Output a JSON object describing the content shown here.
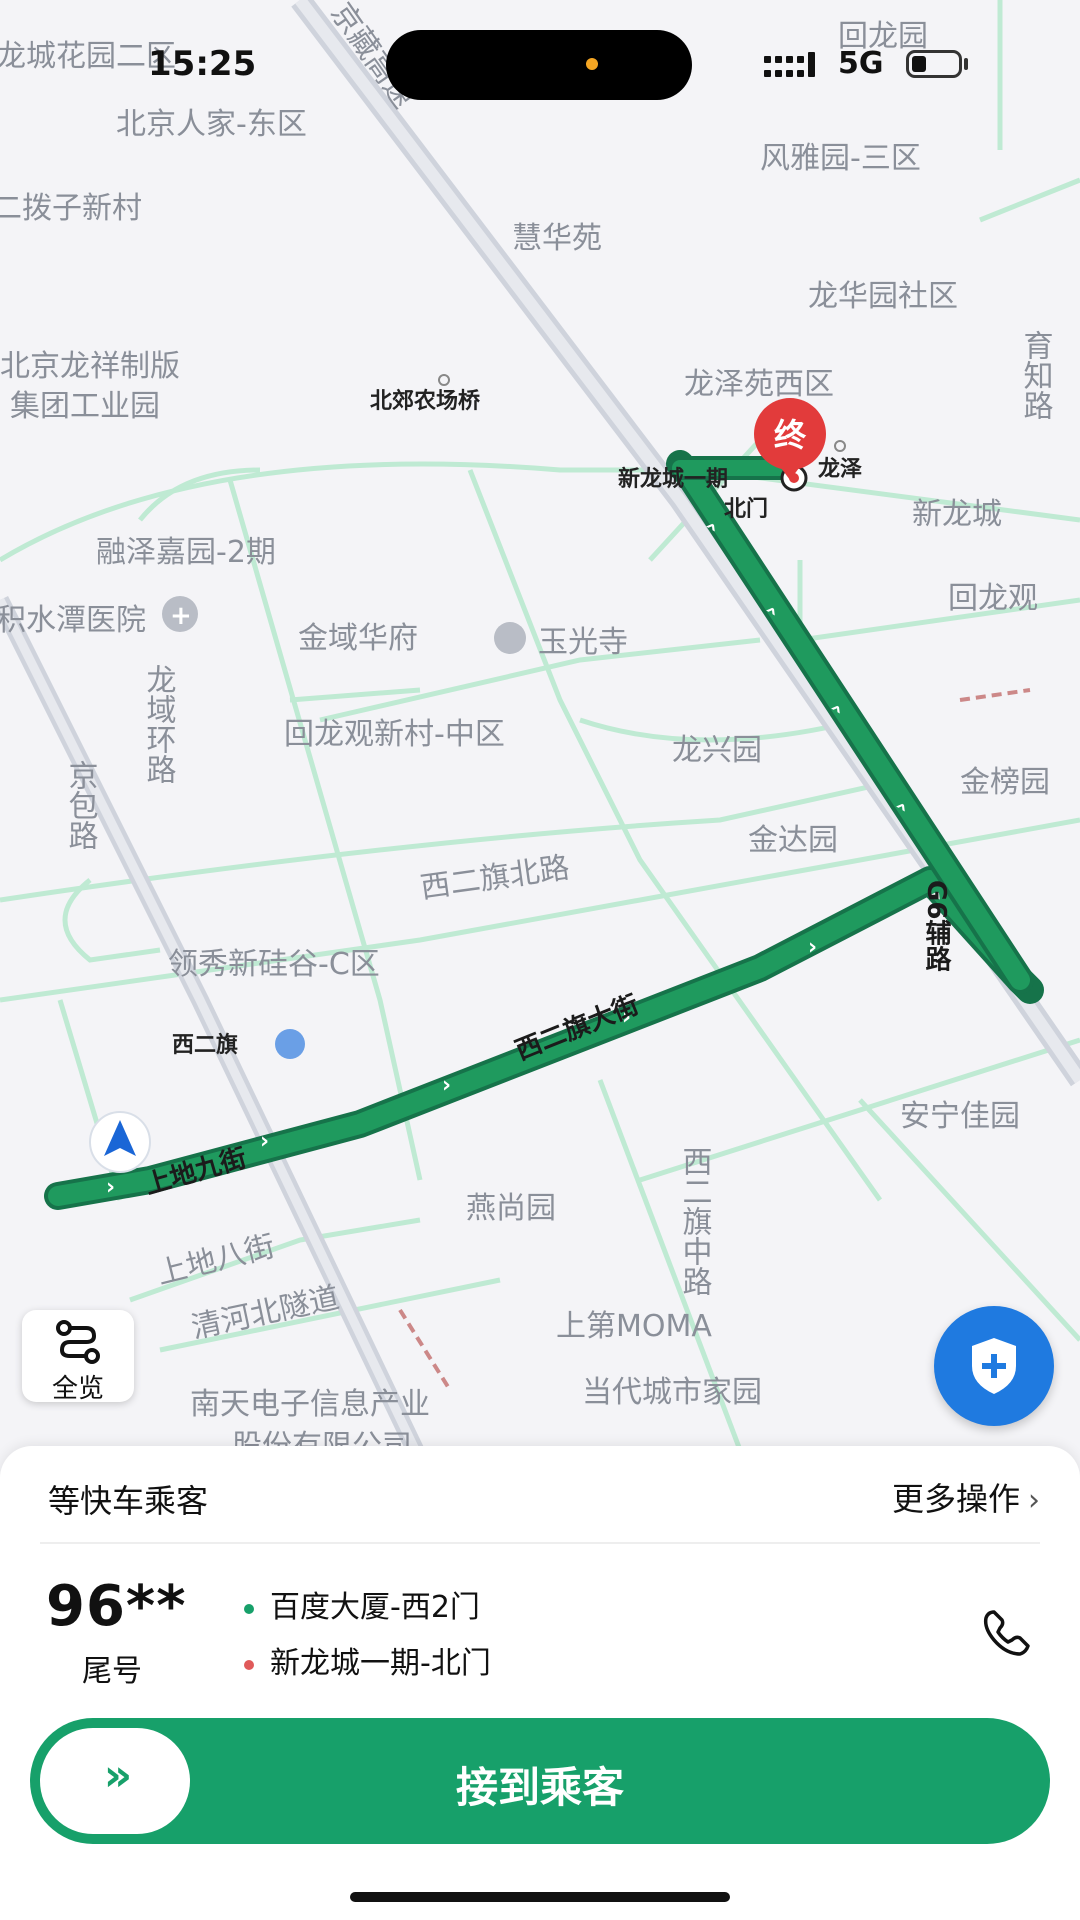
{
  "status_bar": {
    "time": "15:25",
    "network": "5G"
  },
  "map": {
    "labels": [
      {
        "id": "l1",
        "text": "龙城花园二区"
      },
      {
        "id": "l2",
        "text": "北京人家-东区"
      },
      {
        "id": "l3",
        "text": "二拨子新村"
      },
      {
        "id": "l4",
        "text": "慧华苑"
      },
      {
        "id": "l5",
        "text": "回龙园"
      },
      {
        "id": "l6",
        "text": "风雅园-三区"
      },
      {
        "id": "l7",
        "text": "龙华园社区"
      },
      {
        "id": "l8",
        "text": "北京龙祥制版"
      },
      {
        "id": "l9",
        "text": "集团工业园"
      },
      {
        "id": "l10",
        "text": "龙泽苑西区"
      },
      {
        "id": "l11",
        "text": "新龙城"
      },
      {
        "id": "l12",
        "text": "融泽嘉园-2期"
      },
      {
        "id": "l13",
        "text": "积水潭医院"
      },
      {
        "id": "l14",
        "text": "金域华府"
      },
      {
        "id": "l15",
        "text": "玉光寺"
      },
      {
        "id": "l16",
        "text": "回龙观"
      },
      {
        "id": "l17",
        "text": "回龙观新村-中区"
      },
      {
        "id": "l18",
        "text": "龙兴园"
      },
      {
        "id": "l19",
        "text": "金榜园"
      },
      {
        "id": "l20",
        "text": "金达园"
      },
      {
        "id": "l21",
        "text": "领秀新硅谷-C区"
      },
      {
        "id": "l22",
        "text": "西二旗"
      },
      {
        "id": "l23",
        "text": "安宁佳园"
      },
      {
        "id": "l24",
        "text": "燕尚园"
      },
      {
        "id": "l25",
        "text": "上第MOMA"
      },
      {
        "id": "l26",
        "text": "当代城市家园"
      },
      {
        "id": "l27",
        "text": "南天电子信息产业"
      },
      {
        "id": "l28",
        "text": "股份有限公司"
      }
    ],
    "small_labels": {
      "beijiao": "北郊农场桥",
      "longze": "龙泽",
      "xinlongcheng_stop": "新龙城一期",
      "beimen": "北门"
    },
    "road_labels": {
      "jingzang": "京藏高速",
      "yuzhi": "育知路",
      "longyu": "龙域环路",
      "jingbao": "京包路",
      "xierqi_north": "西二旗北路",
      "xierqi_main": "西二旗大街",
      "g6": "G6辅路",
      "shangdi9": "上地九街",
      "shangdi8": "上地八街",
      "qinghe": "清河北隧道",
      "xierqi_mid": "西二旗中路"
    },
    "destination_marker": "终",
    "route_color": "#1f9a5e",
    "road_color": "#bfead3"
  },
  "controls": {
    "overview_label": "全览"
  },
  "panel": {
    "title": "等快车乘客",
    "more_label": "更多操作",
    "plate": "96**",
    "plate_sub": "尾号",
    "pickup": "百度大厦-西2门",
    "dropoff": "新龙城一期-北门",
    "cta_label": "接到乘客",
    "cta_knob": "»",
    "accent": "#17a06a"
  }
}
